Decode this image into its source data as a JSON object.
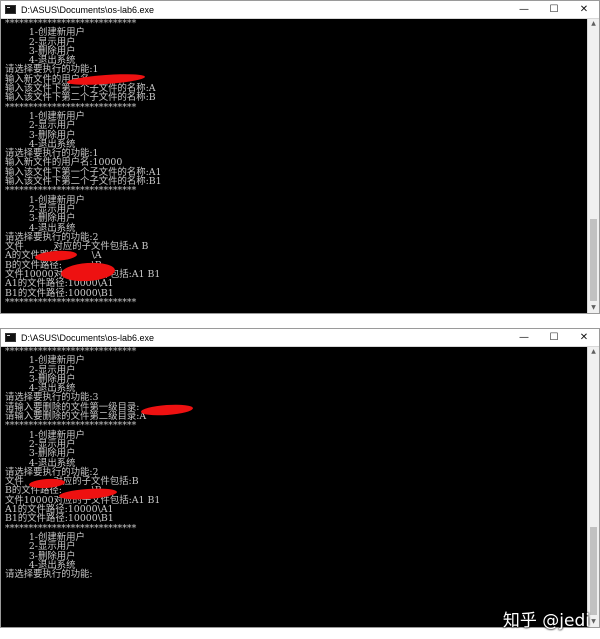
{
  "windows": [
    {
      "title": "D:\\ASUS\\Documents\\os-lab6.exe",
      "lines": [
        "****************************",
        "        1-创建新用户",
        "        2-显示用户",
        "        3-删除用户",
        "        4-退出系统",
        "请选择要执行的功能:1",
        "输入新文件的用户名:",
        "输入该文件下第一个子文件的名称:A",
        "输入该文件下第二个子文件的名称:B",
        "****************************",
        "        1-创建新用户",
        "        2-显示用户",
        "        3-删除用户",
        "        4-退出系统",
        "请选择要执行的功能:1",
        "输入新文件的用户名:10000",
        "输入该文件下第一个子文件的名称:A1",
        "输入该文件下第二个子文件的名称:B1",
        "****************************",
        "        1-创建新用户",
        "        2-显示用户",
        "        3-删除用户",
        "        4-退出系统",
        "请选择要执行的功能:2",
        "文件          对应的子文件包括:A B",
        "A的文件路径:          \\A",
        "B的文件路径:          \\B",
        "文件10000对应的子文件包括:A1 B1",
        "A1的文件路径:10000\\A1",
        "B1的文件路径:10000\\B1",
        "****************************"
      ]
    },
    {
      "title": "D:\\ASUS\\Documents\\os-lab6.exe",
      "lines": [
        "****************************",
        "        1-创建新用户",
        "        2-显示用户",
        "        3-删除用户",
        "        4-退出系统",
        "请选择要执行的功能:3",
        "请输入要删除的文件第一级目录:",
        "请输入要删除的文件第二级目录:A",
        "****************************",
        "        1-创建新用户",
        "        2-显示用户",
        "        3-删除用户",
        "        4-退出系统",
        "请选择要执行的功能:2",
        "文件          对应的子文件包括:B",
        "B的文件路径:          \\B",
        "文件10000对应的子文件包括:A1 B1",
        "A1的文件路径:10000\\A1",
        "B1的文件路径:10000\\B1",
        "****************************",
        "        1-创建新用户",
        "        2-显示用户",
        "        3-删除用户",
        "        4-退出系统",
        "请选择要执行的功能:"
      ]
    }
  ],
  "caption_buttons": {
    "minimize": "—",
    "maximize": "☐",
    "close": "✕"
  },
  "watermark": "知乎 @jedi",
  "colors": {
    "console_bg": "#000000",
    "console_text": "#c8c8c8",
    "redaction": "#e11111"
  }
}
